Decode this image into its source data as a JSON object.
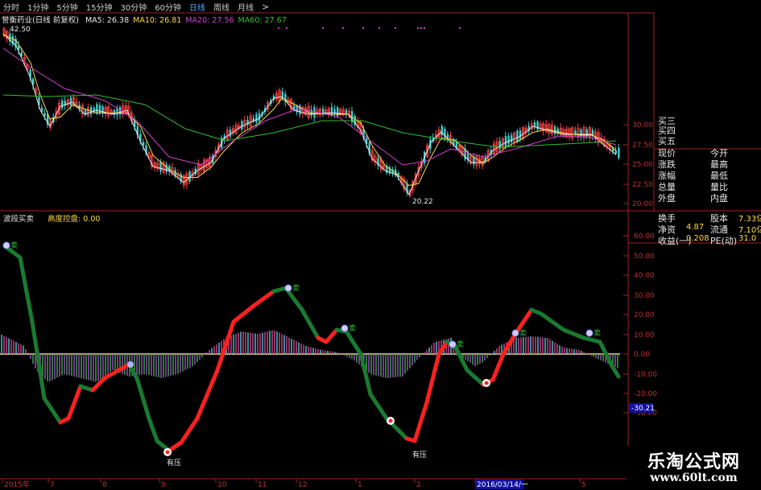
{
  "toolbar": {
    "items": [
      "分时",
      "1分钟",
      "5分钟",
      "15分钟",
      "30分钟",
      "60分钟",
      "日线",
      "周线",
      "月线"
    ],
    "active": "日线",
    "more": ">"
  },
  "price_panel": {
    "stock_label": "誉衡药业(日线 前复权)",
    "ma": [
      {
        "label": "MA5: 26.38",
        "color": "#e6e6e6"
      },
      {
        "label": "MA10: 26.81",
        "color": "#ffd84a"
      },
      {
        "label": "MA20: 27.56",
        "color": "#d040d0"
      },
      {
        "label": "MA60: 27.67",
        "color": "#30c030"
      }
    ],
    "high_label": "42.50",
    "low_label": "20.22",
    "y_ticks": [
      "30.00",
      "27.50",
      "25.00",
      "22.50",
      "20.00"
    ]
  },
  "indicator_panel": {
    "name": "波段买卖",
    "sub": "高度控盘: 0.00",
    "y_ticks": [
      "60.00",
      "50.00",
      "40.00",
      "30.00",
      "20.00",
      "10.00",
      "0.00",
      "-10.00",
      "-20.00",
      "-30.00"
    ],
    "current_value": "-30.21",
    "sell_tag": "卖",
    "pressure_tag": "有压"
  },
  "x_axis": {
    "labels": [
      "2015年",
      "7",
      "8",
      "9",
      "10",
      "11",
      "12",
      "1",
      "2",
      "2016/03/14/一",
      "5"
    ]
  },
  "quote_panel": {
    "asks": [
      "买三",
      "买四",
      "买五"
    ],
    "rows1": [
      [
        "现价",
        "今开"
      ],
      [
        "涨跌",
        "最高"
      ],
      [
        "涨幅",
        "最低"
      ],
      [
        "总量",
        "量比"
      ],
      [
        "外盘",
        "内盘"
      ]
    ],
    "rows2": [
      {
        "l1": "换手",
        "v1": "",
        "l2": "股本",
        "v2": "7.33亿"
      },
      {
        "l1": "净资",
        "v1": "4.87",
        "l2": "流通",
        "v2": "7.10亿"
      },
      {
        "l1": "收益(一)",
        "v1": "0.208",
        "l2": "PE(动)",
        "v2": "31.0"
      }
    ]
  },
  "watermark": {
    "title": "乐淘公式网",
    "url": "www.60lt.com"
  }
}
